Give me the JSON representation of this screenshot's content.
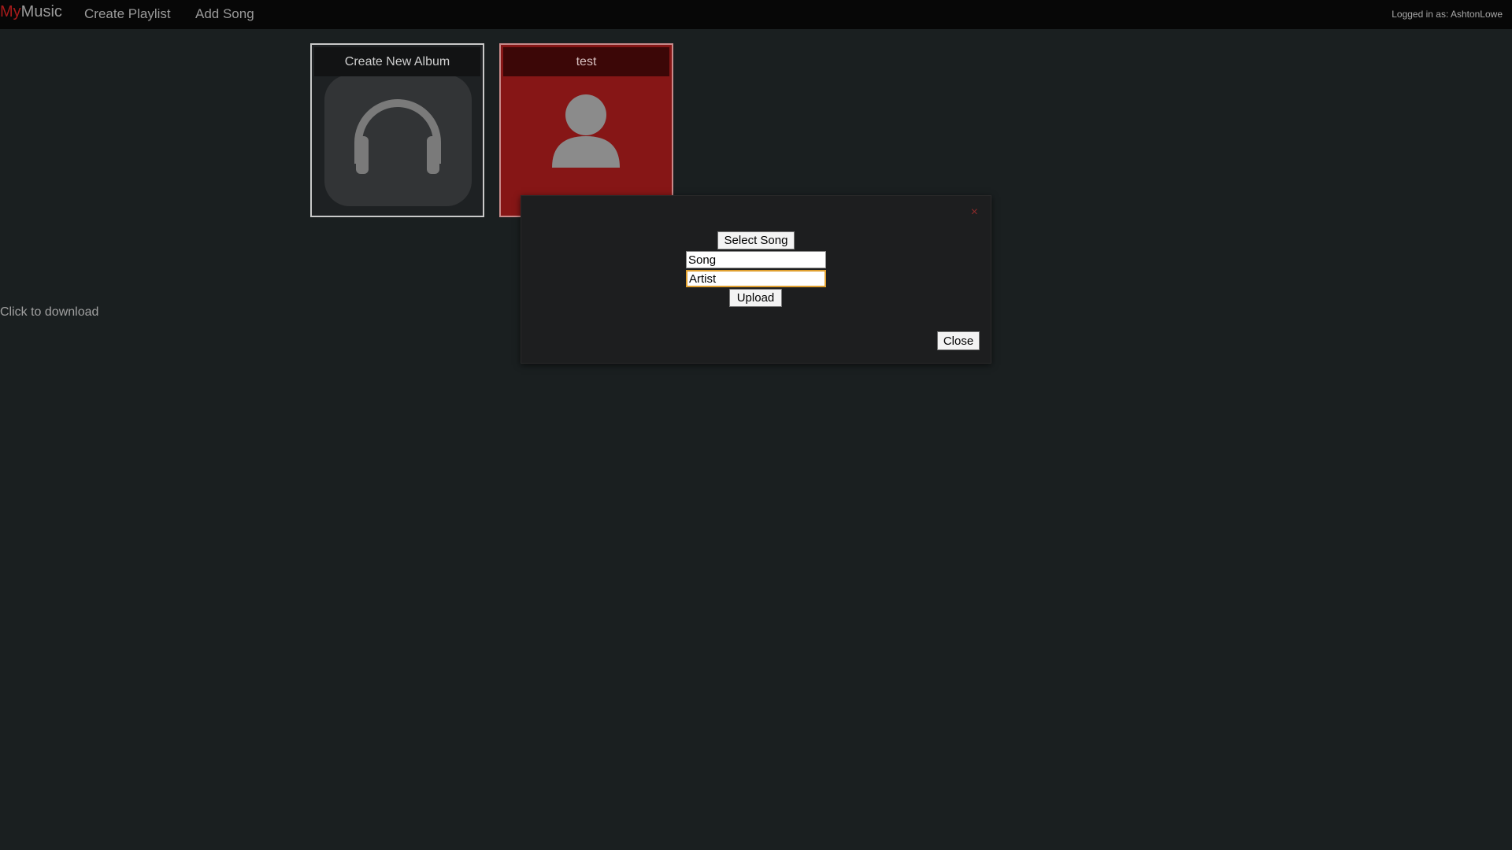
{
  "navbar": {
    "brand_prefix": "My",
    "brand_suffix": "Music",
    "links": [
      "Create Playlist",
      "Add Song"
    ],
    "login_status": "Logged in as: AshtonLowe"
  },
  "albums": [
    {
      "title": "Create New Album",
      "icon": "headphones-icon"
    },
    {
      "title": "test",
      "icon": "person-icon"
    }
  ],
  "dialog": {
    "close_x": "×",
    "select_label": "Select Song",
    "song_value": "Song",
    "artist_value": "Artist",
    "upload_label": "Upload",
    "close_label": "Close"
  },
  "download_text": "Click to download",
  "colors": {
    "background": "#1a1f20",
    "navbar": "#070707",
    "brand_accent": "#a61b1b",
    "album_red": "#861616"
  }
}
